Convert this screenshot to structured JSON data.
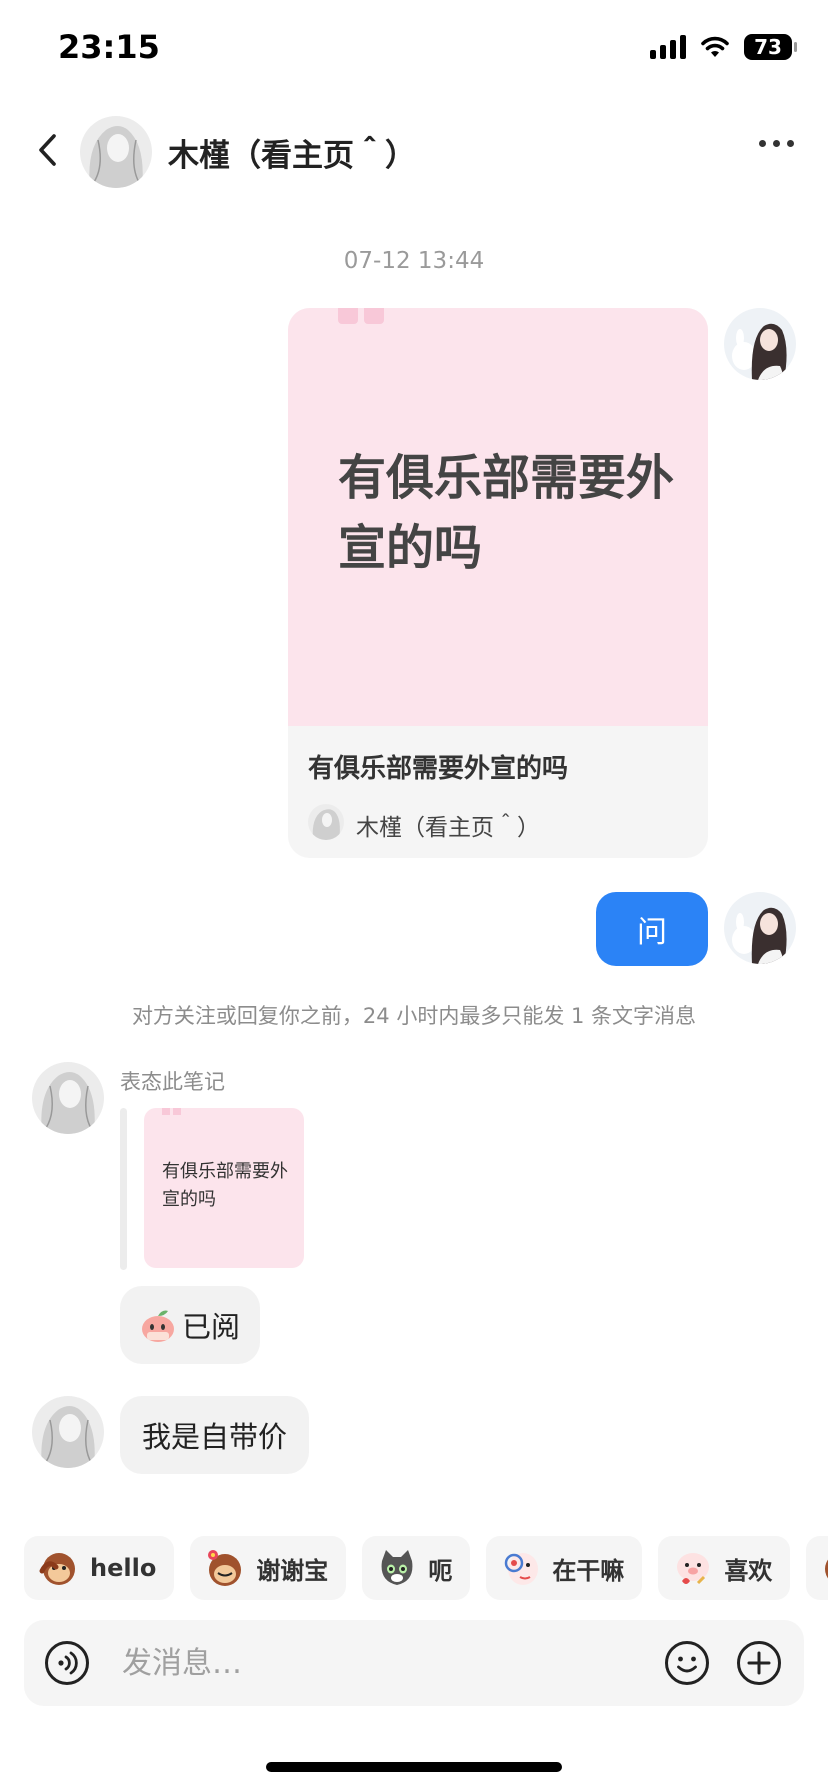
{
  "status_bar": {
    "time": "23:15",
    "battery": "73"
  },
  "header": {
    "title": "木槿（看主页＾）"
  },
  "chat": {
    "timestamp": "07-12 13:44",
    "note_card": {
      "cover_text": "有俱乐部需要外宣的吗",
      "title": "有俱乐部需要外宣的吗",
      "author": "木槿（看主页＾）"
    },
    "sent_message": "问",
    "notice": "对方关注或回复你之前，24 小时内最多只能发 1 条文字消息",
    "reaction_label": "表态此笔记",
    "quoted_card_text": "有俱乐部需要外宣的吗",
    "read_message": "已阅",
    "reply_message": "我是自带价"
  },
  "quick_replies": [
    "hello",
    "谢谢宝",
    "呃",
    "在干嘛",
    "喜欢"
  ],
  "input": {
    "placeholder": "发消息…"
  },
  "colors": {
    "accent": "#2b83f6",
    "card_pink": "#fce4ec",
    "bubble_grey": "#f2f2f2"
  }
}
